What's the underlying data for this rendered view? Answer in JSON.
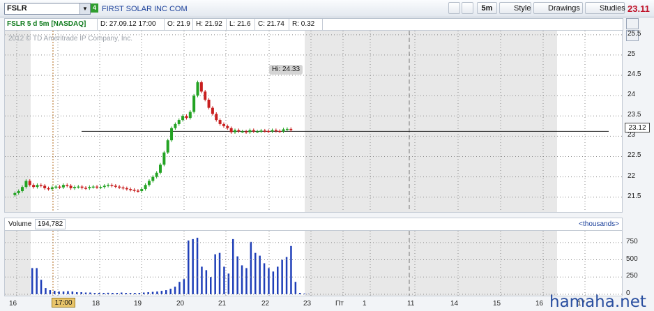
{
  "toolbar": {
    "symbol": "FSLR",
    "link_number": "4",
    "company": "FIRST SOLAR INC COM",
    "aggregation": "5m",
    "style_label": "Style",
    "drawings_label": "Drawings",
    "studies_label": "Studies",
    "last_price": "23.11"
  },
  "info": {
    "title": "FSLR 5 d 5m [NASDAQ]",
    "date": "D: 27.09.12 17:00",
    "open": "O: 21.9",
    "high": "H: 21.92",
    "low": "L: 21.6",
    "close": "C: 21.74",
    "range": "R: 0.32"
  },
  "price_chart": {
    "copyright": "2012 © TD Ameritrade IP Company, Inc.",
    "hi_label": "Hi: 24.33",
    "last_price_marker": "23.12",
    "y_ticks": [
      "25.5",
      "25",
      "24.5",
      "24",
      "23.5",
      "23",
      "22.5",
      "22",
      "21.5"
    ]
  },
  "volume": {
    "label": "Volume",
    "value": "194,782",
    "units": "<thousands>",
    "y_ticks": [
      "750",
      "500",
      "250",
      "0"
    ]
  },
  "x_axis": [
    "16",
    "17:00",
    "18",
    "19",
    "20",
    "21",
    "22",
    "23",
    "Пт",
    "1",
    "11",
    "14",
    "15",
    "16",
    "17"
  ],
  "colors": {
    "up": "#23a323",
    "down": "#c81e1e",
    "volume": "#1f3fb8",
    "shade": "#e8e8e8"
  },
  "watermark": "hamaha.net",
  "chart_data": {
    "type": "candlestick",
    "title": "FSLR 5 d 5m [NASDAQ]",
    "ylim": [
      21.1,
      25.6
    ],
    "price_path": [
      21.55,
      21.6,
      21.65,
      21.75,
      21.9,
      21.8,
      21.75,
      21.8,
      21.78,
      21.72,
      21.7,
      21.74,
      21.76,
      21.74,
      21.8,
      21.78,
      21.72,
      21.75,
      21.76,
      21.73,
      21.72,
      21.75,
      21.76,
      21.74,
      21.75,
      21.78,
      21.8,
      21.78,
      21.76,
      21.74,
      21.72,
      21.7,
      21.68,
      21.66,
      21.65,
      21.7,
      21.8,
      21.9,
      22.0,
      22.1,
      22.3,
      22.6,
      22.9,
      23.2,
      23.3,
      23.4,
      23.5,
      23.45,
      23.6,
      24.0,
      24.33,
      24.1,
      23.9,
      23.7,
      23.55,
      23.4,
      23.3,
      23.25,
      23.2,
      23.1,
      23.15,
      23.12,
      23.12,
      23.1,
      23.15,
      23.12,
      23.12,
      23.14,
      23.13,
      23.12,
      23.15,
      23.13,
      23.12,
      23.17,
      23.18,
      23.15
    ],
    "volume_thousands": [
      380,
      380,
      210,
      90,
      60,
      50,
      40,
      40,
      45,
      40,
      30,
      30,
      25,
      25,
      20,
      20,
      20,
      22,
      20,
      20,
      25,
      20,
      20,
      20,
      20,
      25,
      30,
      35,
      40,
      50,
      60,
      80,
      110,
      180,
      220,
      780,
      800,
      820,
      400,
      350,
      250,
      580,
      600,
      400,
      300,
      800,
      550,
      420,
      380,
      760,
      600,
      560,
      450,
      380,
      330,
      400,
      500,
      540,
      700,
      180,
      20,
      10,
      5
    ]
  }
}
